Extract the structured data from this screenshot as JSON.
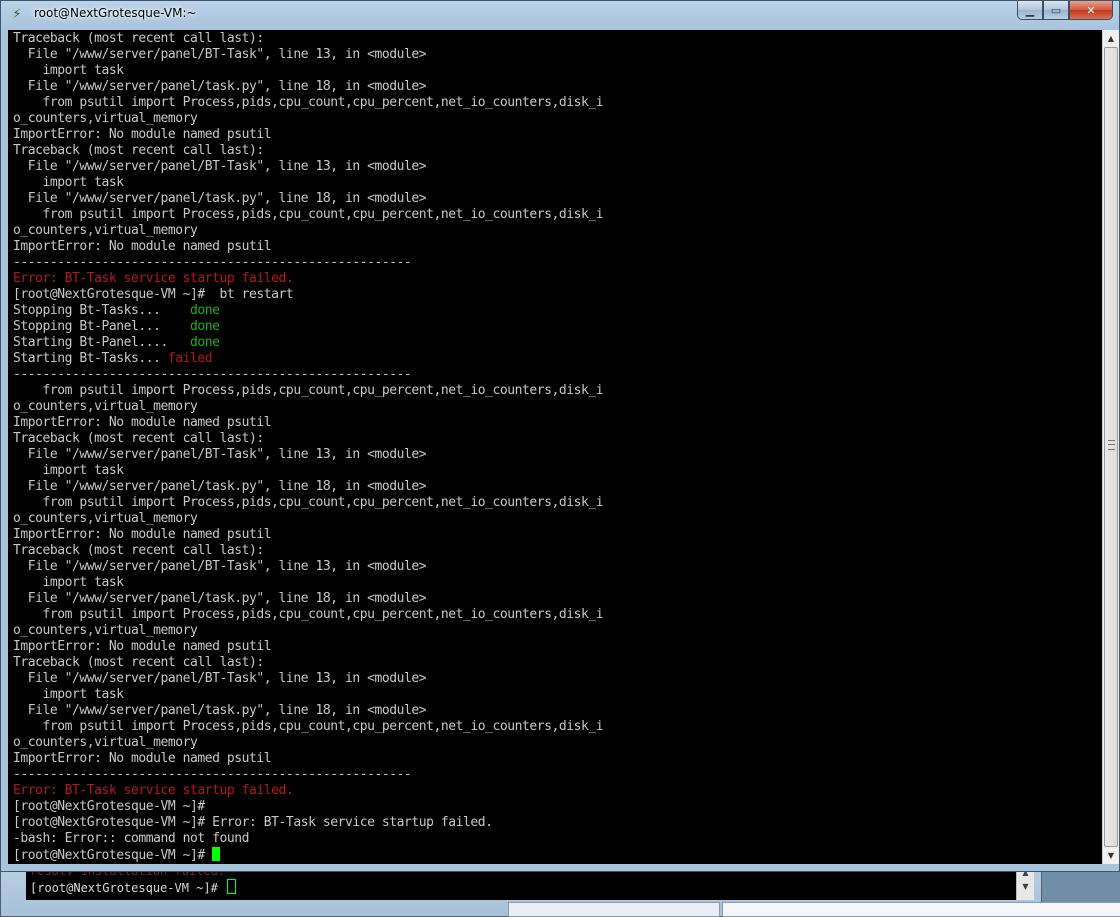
{
  "window": {
    "title": "root@NextGrotesque-VM:~",
    "controls": {
      "minimize": "▁",
      "maximize": "▭",
      "close": "✕"
    }
  },
  "terminal": {
    "lines": [
      [
        {
          "t": "Traceback (most recent call last):"
        }
      ],
      [
        {
          "t": "  File \"/www/server/panel/BT-Task\", line 13, in <module>"
        }
      ],
      [
        {
          "t": "    import task"
        }
      ],
      [
        {
          "t": "  File \"/www/server/panel/task.py\", line 18, in <module>"
        }
      ],
      [
        {
          "t": "    from psutil import Process,pids,cpu_count,cpu_percent,net_io_counters,disk_i"
        }
      ],
      [
        {
          "t": "o_counters,virtual_memory"
        }
      ],
      [
        {
          "t": "ImportError: No module named psutil"
        }
      ],
      [
        {
          "t": "Traceback (most recent call last):"
        }
      ],
      [
        {
          "t": "  File \"/www/server/panel/BT-Task\", line 13, in <module>"
        }
      ],
      [
        {
          "t": "    import task"
        }
      ],
      [
        {
          "t": "  File \"/www/server/panel/task.py\", line 18, in <module>"
        }
      ],
      [
        {
          "t": "    from psutil import Process,pids,cpu_count,cpu_percent,net_io_counters,disk_i"
        }
      ],
      [
        {
          "t": "o_counters,virtual_memory"
        }
      ],
      [
        {
          "t": "ImportError: No module named psutil"
        }
      ],
      [
        {
          "t": "------------------------------------------------------"
        }
      ],
      [
        {
          "t": "Error: BT-Task service startup failed.",
          "c": "red"
        }
      ],
      [
        {
          "t": "[root@NextGrotesque-VM ~]#  bt restart"
        }
      ],
      [
        {
          "t": "Stopping Bt-Tasks...    "
        },
        {
          "t": "done",
          "c": "green"
        }
      ],
      [
        {
          "t": "Stopping Bt-Panel...    "
        },
        {
          "t": "done",
          "c": "green"
        }
      ],
      [
        {
          "t": "Starting Bt-Panel....   "
        },
        {
          "t": "done",
          "c": "green"
        }
      ],
      [
        {
          "t": "Starting Bt-Tasks... "
        },
        {
          "t": "failed",
          "c": "red"
        }
      ],
      [
        {
          "t": "------------------------------------------------------"
        }
      ],
      [
        {
          "t": "    from psutil import Process,pids,cpu_count,cpu_percent,net_io_counters,disk_i"
        }
      ],
      [
        {
          "t": "o_counters,virtual_memory"
        }
      ],
      [
        {
          "t": "ImportError: No module named psutil"
        }
      ],
      [
        {
          "t": "Traceback (most recent call last):"
        }
      ],
      [
        {
          "t": "  File \"/www/server/panel/BT-Task\", line 13, in <module>"
        }
      ],
      [
        {
          "t": "    import task"
        }
      ],
      [
        {
          "t": "  File \"/www/server/panel/task.py\", line 18, in <module>"
        }
      ],
      [
        {
          "t": "    from psutil import Process,pids,cpu_count,cpu_percent,net_io_counters,disk_i"
        }
      ],
      [
        {
          "t": "o_counters,virtual_memory"
        }
      ],
      [
        {
          "t": "ImportError: No module named psutil"
        }
      ],
      [
        {
          "t": "Traceback (most recent call last):"
        }
      ],
      [
        {
          "t": "  File \"/www/server/panel/BT-Task\", line 13, in <module>"
        }
      ],
      [
        {
          "t": "    import task"
        }
      ],
      [
        {
          "t": "  File \"/www/server/panel/task.py\", line 18, in <module>"
        }
      ],
      [
        {
          "t": "    from psutil import Process,pids,cpu_count,cpu_percent,net_io_counters,disk_i"
        }
      ],
      [
        {
          "t": "o_counters,virtual_memory"
        }
      ],
      [
        {
          "t": "ImportError: No module named psutil"
        }
      ],
      [
        {
          "t": "Traceback (most recent call last):"
        }
      ],
      [
        {
          "t": "  File \"/www/server/panel/BT-Task\", line 13, in <module>"
        }
      ],
      [
        {
          "t": "    import task"
        }
      ],
      [
        {
          "t": "  File \"/www/server/panel/task.py\", line 18, in <module>"
        }
      ],
      [
        {
          "t": "    from psutil import Process,pids,cpu_count,cpu_percent,net_io_counters,disk_i"
        }
      ],
      [
        {
          "t": "o_counters,virtual_memory"
        }
      ],
      [
        {
          "t": "ImportError: No module named psutil"
        }
      ],
      [
        {
          "t": "------------------------------------------------------"
        }
      ],
      [
        {
          "t": "Error: BT-Task service startup failed.",
          "c": "red"
        }
      ],
      [
        {
          "t": "[root@NextGrotesque-VM ~]#"
        }
      ],
      [
        {
          "t": "[root@NextGrotesque-VM ~]# Error: BT-Task service startup failed."
        }
      ],
      [
        {
          "t": "-bash: Error:: command not found"
        }
      ],
      [
        {
          "t": "[root@NextGrotesque-VM ~]# "
        },
        {
          "cursor": true
        }
      ]
    ]
  },
  "background_window": {
    "faded_text": "resolv installation failed.",
    "prompt": "[root@NextGrotesque-VM ~]#"
  },
  "colors": {
    "terminal_bg": "#000000",
    "terminal_fg": "#c8c8c8",
    "error_red": "#b21a1a",
    "ok_green": "#18b218",
    "cursor_green": "#00ff00"
  },
  "icons": {
    "app": "putty-icon",
    "scroll_up": "scroll-up-arrow-icon",
    "scroll_down": "scroll-down-arrow-icon"
  }
}
